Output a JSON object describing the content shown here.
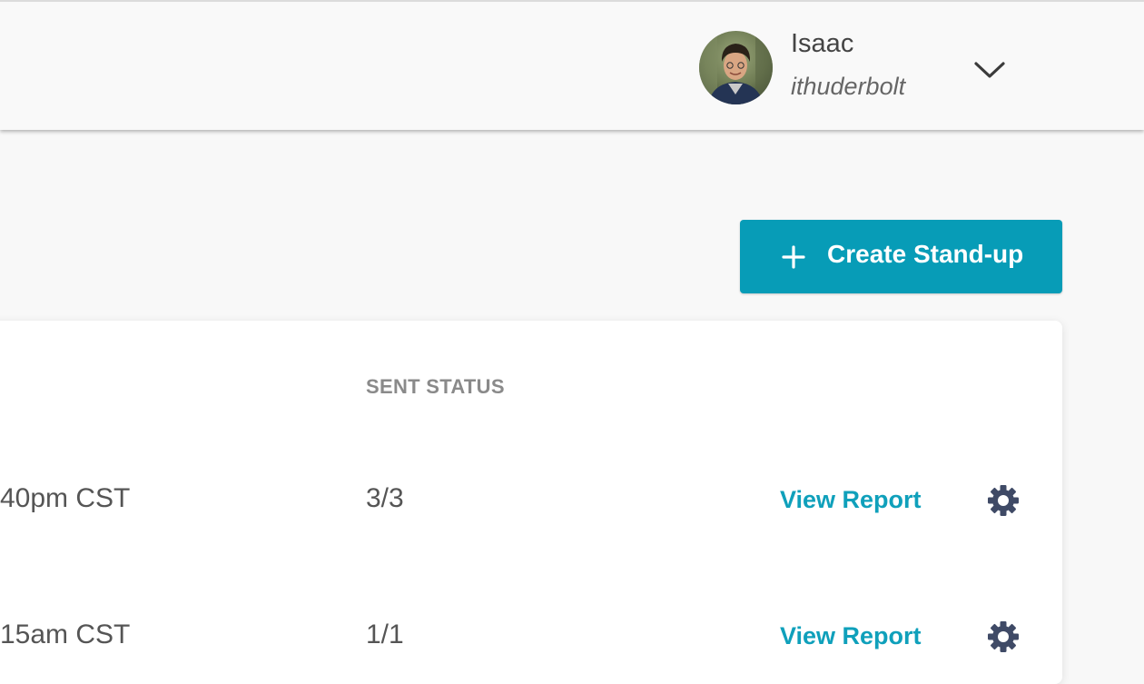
{
  "header": {
    "user_name": "Isaac",
    "user_handle": "ithuderbolt",
    "avatar_icon": "user-avatar-photo",
    "dropdown_icon": "chevron-down-icon"
  },
  "actions": {
    "create_label": "Create Stand-up",
    "create_icon": "plus-icon",
    "accent_color": "#079cb7"
  },
  "table": {
    "columns": [
      "SENT STATUS"
    ],
    "rows": [
      {
        "time": "40pm CST",
        "sent_status": "3/3",
        "link_label": "View Report",
        "settings_icon": "gear-icon"
      },
      {
        "time": "15am CST",
        "sent_status": "1/1",
        "link_label": "View Report",
        "settings_icon": "gear-icon"
      }
    ]
  }
}
